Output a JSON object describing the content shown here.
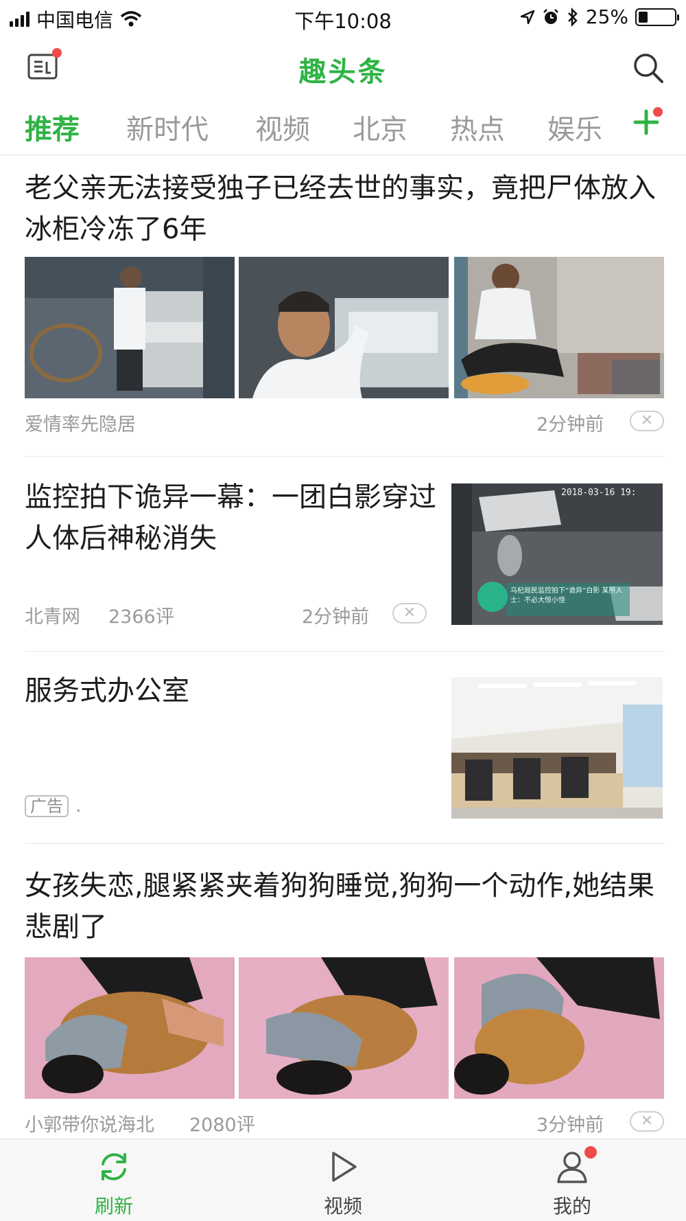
{
  "status_bar": {
    "carrier": "中国电信",
    "time": "下午10:08",
    "battery_percent": "25%",
    "battery_level": 0.25
  },
  "header": {
    "title": "趣头条",
    "left_icon": "news-icon",
    "right_icon": "search-icon"
  },
  "tabs": [
    {
      "label": "推荐",
      "active": true
    },
    {
      "label": "新时代",
      "active": false
    },
    {
      "label": "视频",
      "active": false
    },
    {
      "label": "北京",
      "active": false
    },
    {
      "label": "热点",
      "active": false
    },
    {
      "label": "娱乐",
      "active": false
    }
  ],
  "feed": [
    {
      "title": "老父亲无法接受独子已经去世的事实，竟把尸体放入冰柜冷冻了6年",
      "source": "爱情率先隐居",
      "time": "2分钟前",
      "close": "✕"
    },
    {
      "title": "监控拍下诡异一幕：一团白影穿过人体后神秘消失",
      "source": "北青网",
      "comments": "2366评",
      "time": "2分钟前",
      "close": "✕",
      "image_caption_time": "2018-03-16 19:",
      "image_caption": "乌杞局民监控拍下“诡异”白影 某所人士：不必大惊小怪"
    },
    {
      "title": "服务式办公室",
      "ad_label": "广告",
      "ad_suffix": "."
    },
    {
      "title": "女孩失恋,腿紧紧夹着狗狗睡觉,狗狗一个动作,她结果悲剧了",
      "source": "小郭带你说海北",
      "comments": "2080评",
      "time": "3分钟前",
      "close": "✕"
    }
  ],
  "bottom_nav": [
    {
      "label": "刷新",
      "icon": "refresh-icon",
      "active": true
    },
    {
      "label": "视频",
      "icon": "play-icon",
      "active": false
    },
    {
      "label": "我的",
      "icon": "profile-icon",
      "active": false
    }
  ],
  "colors": {
    "accent": "#2fb344",
    "badge": "#f04a4a",
    "meta_text": "#9a9a9a"
  }
}
